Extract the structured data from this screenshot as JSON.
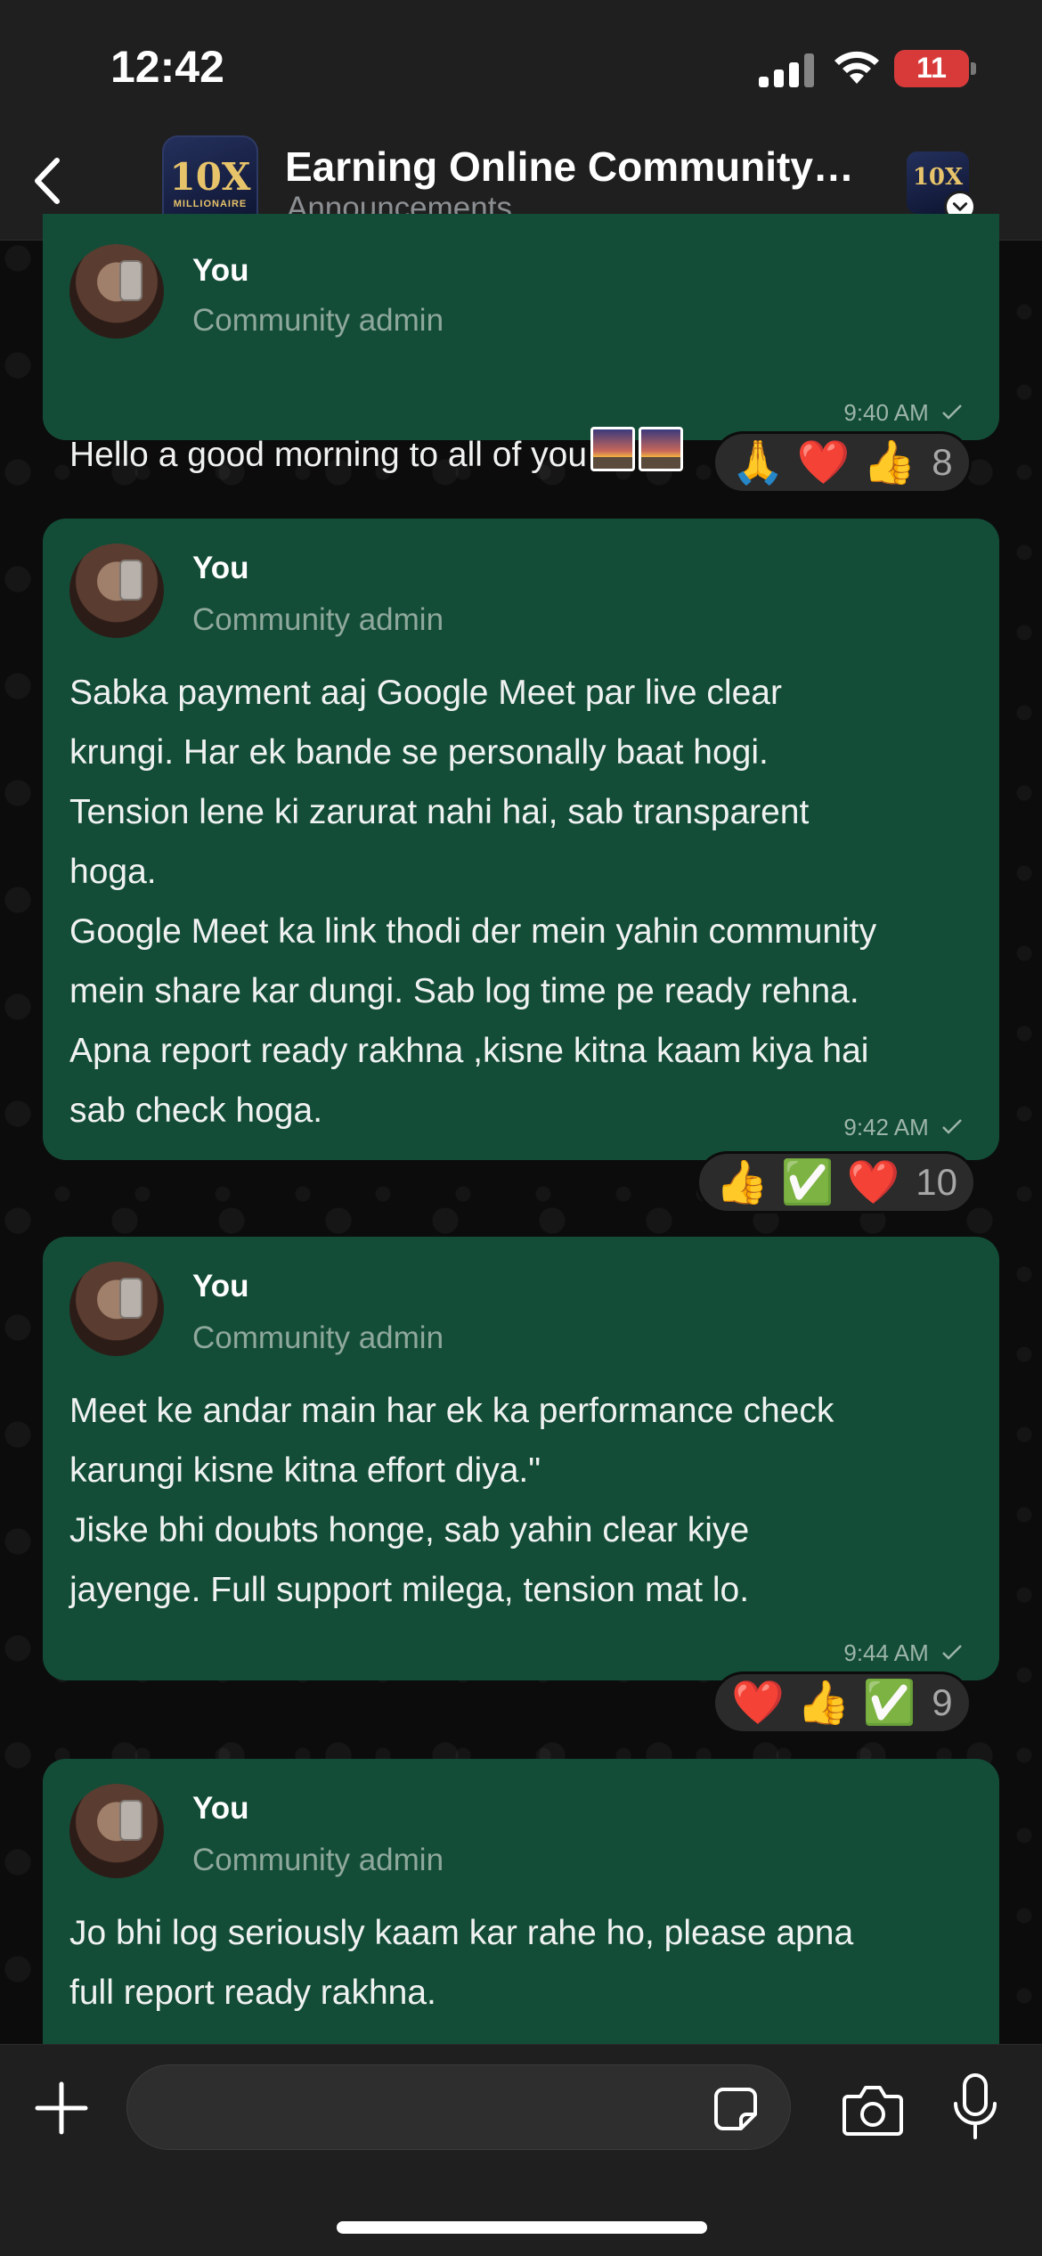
{
  "status_bar": {
    "time": "12:42",
    "battery": "11",
    "battery_color": "#d83a3a"
  },
  "header": {
    "title": "Earning Online Community…",
    "subtitle": "Announcements",
    "avatar_text": "10X",
    "avatar_subtext": "MILLIONAIRE",
    "community_avatar_text": "10X"
  },
  "messages": [
    {
      "sender": "You",
      "role": "Community admin",
      "text": "Hello a good morning to all of you",
      "time": "9:40 AM",
      "reactions": [
        "🙏",
        "❤️",
        "👍"
      ],
      "reaction_count": "8"
    },
    {
      "sender": "You",
      "role": "Community admin",
      "text": "Sabka payment aaj Google Meet par live clear\nkrungi. Har ek bande se personally baat hogi.\nTension lene ki zarurat nahi hai, sab transparent\nhoga.\nGoogle Meet ka link thodi der mein yahin community\nmein share kar dungi. Sab log time pe ready rehna.\nApna report ready rakhna ,kisne kitna kaam kiya hai\nsab check hoga.",
      "time": "9:42 AM",
      "reactions": [
        "👍",
        "✅",
        "❤️"
      ],
      "reaction_count": "10"
    },
    {
      "sender": "You",
      "role": "Community admin",
      "text": "Meet ke andar main har ek ka performance check\nkarungi kisne kitna effort diya.\"\nJiske bhi doubts honge, sab yahin clear kiye\njayenge. Full support milega, tension mat lo.",
      "time": "9:44 AM",
      "reactions": [
        "❤️",
        "👍",
        "✅"
      ],
      "reaction_count": "9"
    },
    {
      "sender": "You",
      "role": "Community admin",
      "text": "Jo bhi log seriously kaam kar rahe ho, please apna\nfull report ready rakhna."
    }
  ],
  "colors": {
    "bubble": "#134d37",
    "background": "#0c0c0c",
    "bar": "#1f1f1f"
  }
}
